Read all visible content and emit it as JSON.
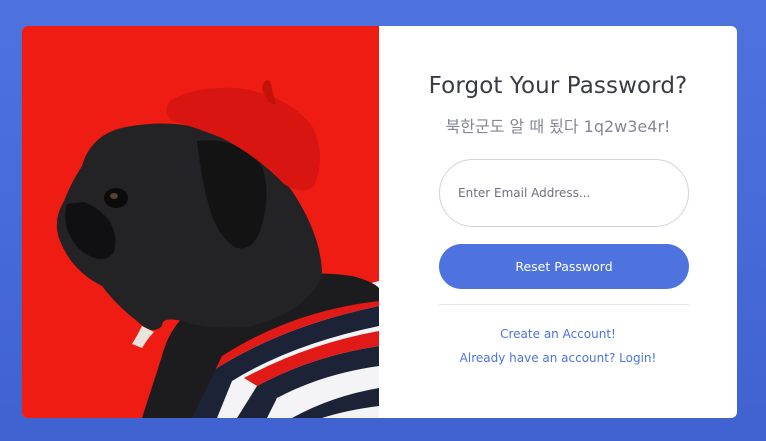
{
  "colors": {
    "background": "#4e73df",
    "card": "#ffffff",
    "primary": "#4e73df",
    "photo_background": "#ef1c14",
    "title_text": "#3a3b45",
    "muted_text": "#858796"
  },
  "photo": {
    "subject": "pug-in-red-beret-photo"
  },
  "form": {
    "title": "Forgot Your Password?",
    "subtitle": "북한군도 알 때 됬다 1q2w3e4r!",
    "email": {
      "placeholder": "Enter Email Address...",
      "value": ""
    },
    "reset_button_label": "Reset Password"
  },
  "links": {
    "create_account": "Create an Account!",
    "login": "Already have an account? Login!"
  }
}
